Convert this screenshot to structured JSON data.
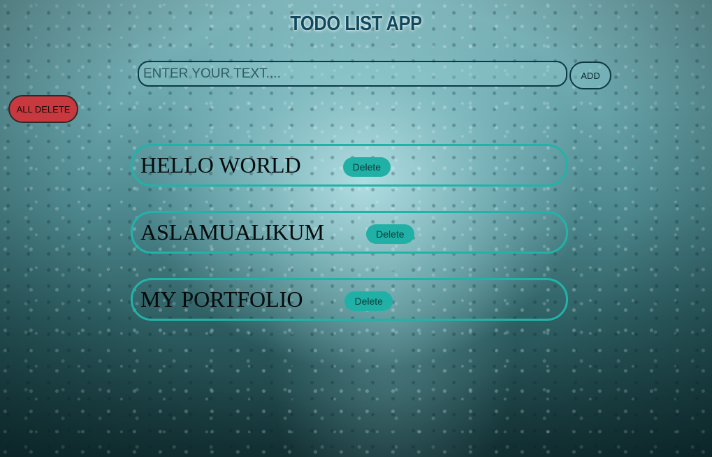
{
  "app": {
    "title": "TODO LIST APP"
  },
  "input": {
    "placeholder": "ENTER YOUR TEXT....",
    "value": ""
  },
  "buttons": {
    "add_label": "ADD",
    "all_delete_label": "ALL DELETE"
  },
  "todos": [
    {
      "text": "HELLO WORLD",
      "delete_label": "Delete"
    },
    {
      "text": "ASLAMUALIKUM",
      "delete_label": "Delete"
    },
    {
      "text": "MY PORTFOLIO",
      "delete_label": "Delete"
    }
  ],
  "colors": {
    "title": "#0f4a5e",
    "item_border": "#22b3a8",
    "delete_button": "#20b0a5",
    "all_delete_button": "#c8383f"
  }
}
